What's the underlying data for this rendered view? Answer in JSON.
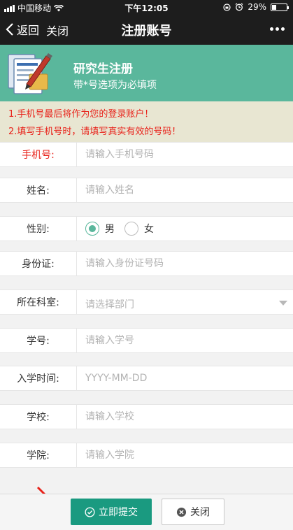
{
  "status_bar": {
    "carrier": "中国移动",
    "time": "下午12:05",
    "battery": "29%",
    "battery_level": 0.29
  },
  "nav": {
    "back_label": "返回",
    "close_label": "关闭",
    "title": "注册账号"
  },
  "banner": {
    "title": "研究生注册",
    "subtitle": "带*号选项为必填项"
  },
  "notice": {
    "line1": "1.手机号最后将作为您的登录账户！",
    "line2": "2.填写手机号时，请填写真实有效的号码！"
  },
  "form": {
    "phone": {
      "label": "手机号:",
      "placeholder": "请输入手机号码",
      "value": ""
    },
    "name": {
      "label": "姓名:",
      "placeholder": "请输入姓名",
      "value": ""
    },
    "gender": {
      "label": "性别:",
      "options": [
        "男",
        "女"
      ],
      "selected": "男"
    },
    "id_card": {
      "label": "身份证:",
      "placeholder": "请输入身份证号码",
      "value": ""
    },
    "department": {
      "label": "所在科室:",
      "placeholder": "请选择部门"
    },
    "student_id": {
      "label": "学号:",
      "placeholder": "请输入学号",
      "value": ""
    },
    "enroll_date": {
      "label": "入学时间:",
      "placeholder": "YYYY-MM-DD",
      "value": ""
    },
    "school": {
      "label": "学校:",
      "placeholder": "请输入学校",
      "value": ""
    },
    "college": {
      "label": "学院:",
      "placeholder": "请输入学院",
      "value": ""
    }
  },
  "actions": {
    "submit_label": "立即提交",
    "close_label": "关闭"
  },
  "colors": {
    "accent": "#5ab79c",
    "submit": "#1a9a80",
    "warning": "#e8221a",
    "notice_bg": "#e8e6d2"
  }
}
